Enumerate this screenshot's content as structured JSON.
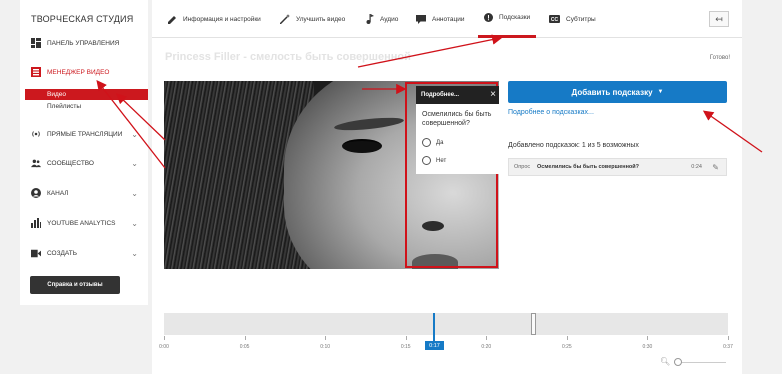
{
  "sidebar": {
    "title": "ТВОРЧЕСКАЯ СТУДИЯ",
    "items": [
      {
        "label": "ПАНЕЛЬ УПРАВЛЕНИЯ",
        "icon": "dashboard-icon"
      },
      {
        "label": "МЕНЕДЖЕР ВИДЕО",
        "icon": "video-manager-icon"
      },
      {
        "label": "ПРЯМЫЕ ТРАНСЛЯЦИИ",
        "icon": "live-icon"
      },
      {
        "label": "СООБЩЕСТВО",
        "icon": "community-icon"
      },
      {
        "label": "КАНАЛ",
        "icon": "channel-icon"
      },
      {
        "label": "YOUTUBE ANALYTICS",
        "icon": "analytics-icon"
      },
      {
        "label": "СОЗДАТЬ",
        "icon": "create-icon"
      }
    ],
    "sub_items": [
      {
        "label": "Видео"
      },
      {
        "label": "Плейлисты"
      }
    ],
    "help_label": "Справка и отзывы"
  },
  "tabs": [
    {
      "label": "Информация и настройки",
      "icon": "pencil-icon"
    },
    {
      "label": "Улучшить видео",
      "icon": "magic-wand-icon"
    },
    {
      "label": "Аудио",
      "icon": "music-note-icon"
    },
    {
      "label": "Аннотации",
      "icon": "comment-icon"
    },
    {
      "label": "Подсказки",
      "icon": "info-icon"
    },
    {
      "label": "Субтитры",
      "icon": "cc-icon"
    }
  ],
  "video": {
    "title": "Princess Filler - смелость быть совершенной",
    "status": "Готово!"
  },
  "card": {
    "header": "Подробнее...",
    "question": "Осмелились бы быть совершенной?",
    "options": [
      "Да",
      "Нет"
    ]
  },
  "hints": {
    "add_button": "Добавить подсказку",
    "more_link": "Подробнее о подсказках...",
    "added_count": "Добавлено подсказок: 1 из 5 возможных",
    "items": [
      {
        "type": "Опрос",
        "title": "Осмелились бы быть совершенной?",
        "time": "0:24"
      }
    ]
  },
  "timeline": {
    "current": "0:17",
    "ticks": [
      "0:00",
      "0:05",
      "0:10",
      "0:15",
      "0:20",
      "0:25",
      "0:30",
      "0:37"
    ]
  },
  "colors": {
    "accent_red": "#cc181e",
    "accent_blue": "#167ac6"
  }
}
